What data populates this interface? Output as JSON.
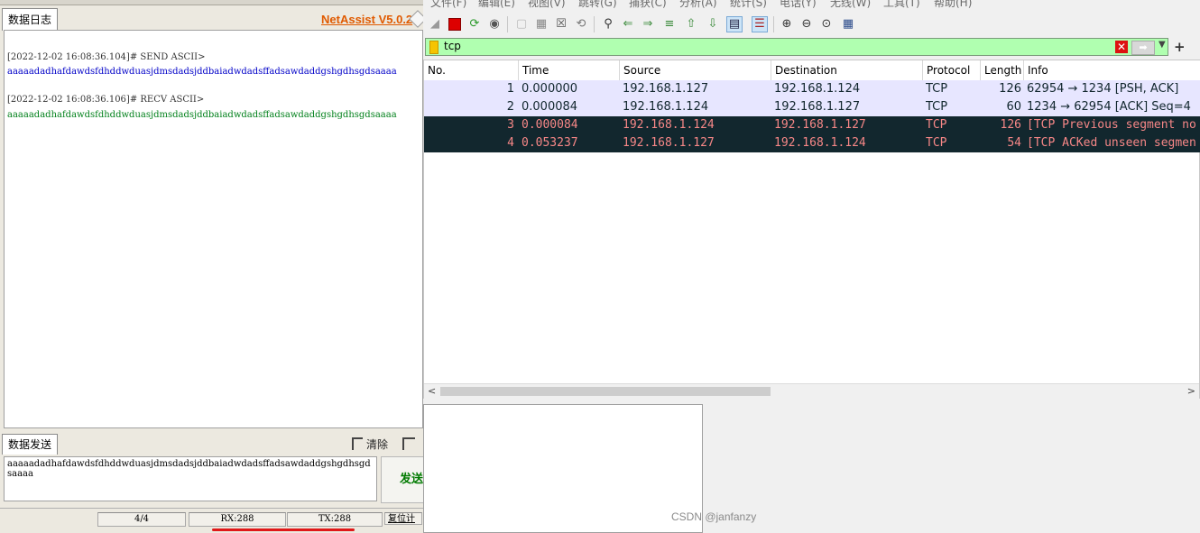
{
  "netassist": {
    "brand": "NetAssist V5.0.2",
    "tab_log": "数据日志",
    "log": [
      {
        "kind": "head",
        "text": "[2022-12-02 16:08:36.104]# SEND ASCII>"
      },
      {
        "kind": "send",
        "text": "aaaaadadhafdawdsfdhddwduasjdmsdadsjddbaiadwdadsffadsawdaddgshgdhsgdsaaaa"
      },
      {
        "kind": "head",
        "text": "[2022-12-02 16:08:36.106]# RECV ASCII>"
      },
      {
        "kind": "recv",
        "text": "aaaaadadhafdawdsfdhddwduasjdmsdadsjddbaiadwdadsffadsawdaddgshgdhsgdsaaaa"
      }
    ],
    "tab_send": "数据发送",
    "clear_label": "清除",
    "send_input": "aaaaadadhafdawdsfdhddwduasjdmsdadsjddbaiadwdadsffadsawdaddgshgdhsgdsaaaa",
    "send_button": "发送",
    "status": {
      "count": "4/4",
      "rx": "RX:288",
      "tx": "TX:288",
      "reset": "复位计"
    }
  },
  "wireshark": {
    "menu": [
      "文件(F)",
      "编辑(E)",
      "视图(V)",
      "跳转(G)",
      "捕获(C)",
      "分析(A)",
      "统计(S)",
      "电话(Y)",
      "无线(W)",
      "工具(T)",
      "帮助(H)"
    ],
    "filter": {
      "value": "tcp"
    },
    "columns": [
      "No.",
      "Time",
      "Source",
      "Destination",
      "Protocol",
      "Length",
      "Info"
    ],
    "packets": [
      {
        "no": "1",
        "time": "0.000000",
        "source": "192.168.1.127",
        "destination": "192.168.1.124",
        "protocol": "TCP",
        "length": "126",
        "info": "62954 → 1234 [PSH, ACK]",
        "style": "normal"
      },
      {
        "no": "2",
        "time": "0.000084",
        "source": "192.168.1.124",
        "destination": "192.168.1.127",
        "protocol": "TCP",
        "length": "60",
        "info": "1234 → 62954 [ACK] Seq=4",
        "style": "normal"
      },
      {
        "no": "3",
        "time": "0.000084",
        "source": "192.168.1.124",
        "destination": "192.168.1.127",
        "protocol": "TCP",
        "length": "126",
        "info": "[TCP Previous segment no",
        "style": "bad"
      },
      {
        "no": "4",
        "time": "0.053237",
        "source": "192.168.1.127",
        "destination": "192.168.1.124",
        "protocol": "TCP",
        "length": "54",
        "info": "[TCP ACKed unseen segmen",
        "style": "bad"
      }
    ]
  },
  "watermark": "CSDN @janfanzy"
}
